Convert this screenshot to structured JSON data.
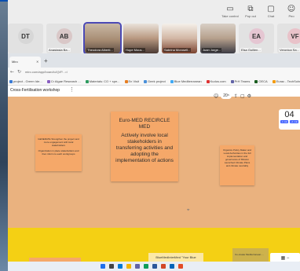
{
  "meeting": {
    "tools": [
      {
        "icon": "laptop-icon",
        "glyph": "▭",
        "label": "Take control"
      },
      {
        "icon": "pop-out-icon",
        "glyph": "⧉",
        "label": "Pop out"
      },
      {
        "icon": "chat-icon",
        "glyph": "▢",
        "label": "Chat"
      },
      {
        "icon": "people-icon",
        "glyph": "☺",
        "label": "Peo"
      }
    ],
    "participants": [
      {
        "initials": "DT",
        "name": "",
        "video": false,
        "color": "#d7d7d7"
      },
      {
        "initials": "AB",
        "name": "Anastasia Ba...",
        "video": false,
        "color": "#d9c7c7"
      },
      {
        "initials": "",
        "name": "Theodora Alberti...",
        "video": true,
        "active": true
      },
      {
        "initials": "",
        "name": "Hope Mous...",
        "video": true
      },
      {
        "initials": "",
        "name": "Sabrina Morosell...",
        "video": true
      },
      {
        "initials": "",
        "name": "Juan Jorge...",
        "video": true
      },
      {
        "initials": "EA",
        "name": "Elsa Guillen...",
        "video": false,
        "color": "#e5c6d2"
      },
      {
        "initials": "VF",
        "name": "Veronica Sa...",
        "video": false,
        "color": "#e9c2c9"
      }
    ]
  },
  "browser": {
    "tab_title": "Miro",
    "url": "miro.com/app/board/uXjVP...=/",
    "bookmarks": [
      {
        "label": "project - Green Ide...",
        "color": "#3a7bd5"
      },
      {
        "label": "Cr Algae Research ...",
        "color": "#8a5fc1"
      },
      {
        "label": "Materials: CO + spe...",
        "color": "#2e9b5f"
      },
      {
        "label": "En Visit",
        "color": "#e67e22"
      },
      {
        "label": "Geek project",
        "color": "#4a90d9"
      },
      {
        "label": "Blue Mediterranean",
        "color": "#3fa9f5"
      },
      {
        "label": "Kudos.com",
        "color": "#d33"
      },
      {
        "label": "PrH Teams",
        "color": "#6264a7"
      },
      {
        "label": "OECA",
        "color": "#1b5e20"
      },
      {
        "label": "Eurac - TechSoln",
        "color": "#f39c12"
      }
    ]
  },
  "board": {
    "name": "Cross-Fertilisation workshop",
    "timer": {
      "value": "04",
      "btn_minus": "-1 min",
      "btn_plus": "+1 min"
    },
    "tools": {
      "label": "20⁵"
    },
    "main_note": {
      "line1": "Euro-MED RECIRCLE MED",
      "line2": "Actively involve local stakeholders in transferring activities and adopting the implementation of actions"
    },
    "left_note": {
      "p1": "GENERATE Strengthen the project and more engagement with local stakeholders",
      "p2": "Organization in place stakeholders and then inform to each workgroups"
    },
    "right_note": {
      "p1": "Organize Policy Maker and Local Authorities in the full implementation and governance of Mission Launched Climate Plans and climate neutrality"
    },
    "sub_note_mid": "BlueMedInterMed \"Your Blue",
    "sub_note_right": "Co-create Mediterranean ..."
  },
  "zoom": {
    "label": "▦  −"
  }
}
